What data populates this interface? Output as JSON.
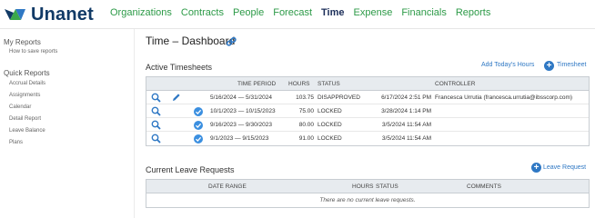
{
  "app": {
    "name": "Unanet"
  },
  "nav": {
    "items": [
      {
        "label": "Organizations",
        "active": false
      },
      {
        "label": "Contracts",
        "active": false
      },
      {
        "label": "People",
        "active": false
      },
      {
        "label": "Forecast",
        "active": false
      },
      {
        "label": "Time",
        "active": true
      },
      {
        "label": "Expense",
        "active": false
      },
      {
        "label": "Financials",
        "active": false
      },
      {
        "label": "Reports",
        "active": false
      }
    ]
  },
  "sidebar": {
    "my_reports": "My Reports",
    "how_to_save": "How to save reports",
    "quick_reports": "Quick Reports",
    "items": [
      "Accrual Details",
      "Assignments",
      "Calendar",
      "Detail Report",
      "Leave Balance",
      "Plans"
    ]
  },
  "page": {
    "title": "Time – Dashboard",
    "link_icon": "link-icon"
  },
  "timesheets": {
    "title": "Active Timesheets",
    "add_today_link": "Add Today's Hours",
    "add_timesheet_link": "Timesheet",
    "columns": {
      "period": "TIME PERIOD",
      "hours": "HOURS",
      "status": "STATUS",
      "controller": "CONTROLLER"
    },
    "rows": [
      {
        "period": "5/16/2024 — 5/31/2024",
        "hours": "103.75",
        "status": "DISAPPROVED",
        "date": "6/17/2024 2:51 PM",
        "controller": "Francesca Urrutia (francesca.urrutia@ibsscorp.com)",
        "editable": true,
        "locked": false
      },
      {
        "period": "10/1/2023 — 10/15/2023",
        "hours": "75.00",
        "status": "LOCKED",
        "date": "3/28/2024 1:14 PM",
        "controller": "",
        "editable": false,
        "locked": true
      },
      {
        "period": "9/16/2023 — 9/30/2023",
        "hours": "80.00",
        "status": "LOCKED",
        "date": "3/5/2024 11:54 AM",
        "controller": "",
        "editable": false,
        "locked": true
      },
      {
        "period": "9/1/2023 — 9/15/2023",
        "hours": "91.00",
        "status": "LOCKED",
        "date": "3/5/2024 11:54 AM",
        "controller": "",
        "editable": false,
        "locked": true
      }
    ]
  },
  "leave": {
    "title": "Current Leave Requests",
    "add_link": "Leave Request",
    "columns": {
      "date_range": "DATE RANGE",
      "hours": "HOURS",
      "status": "STATUS",
      "comments": "COMMENTS"
    },
    "empty_text": "There are no current leave requests."
  },
  "colors": {
    "nav_link": "#2c9a47",
    "nav_active": "#1b2e59",
    "accent_blue": "#2f78c4",
    "header_bg": "#e7ebef",
    "logo_green": "#3aa84a",
    "logo_navy": "#113a66"
  }
}
